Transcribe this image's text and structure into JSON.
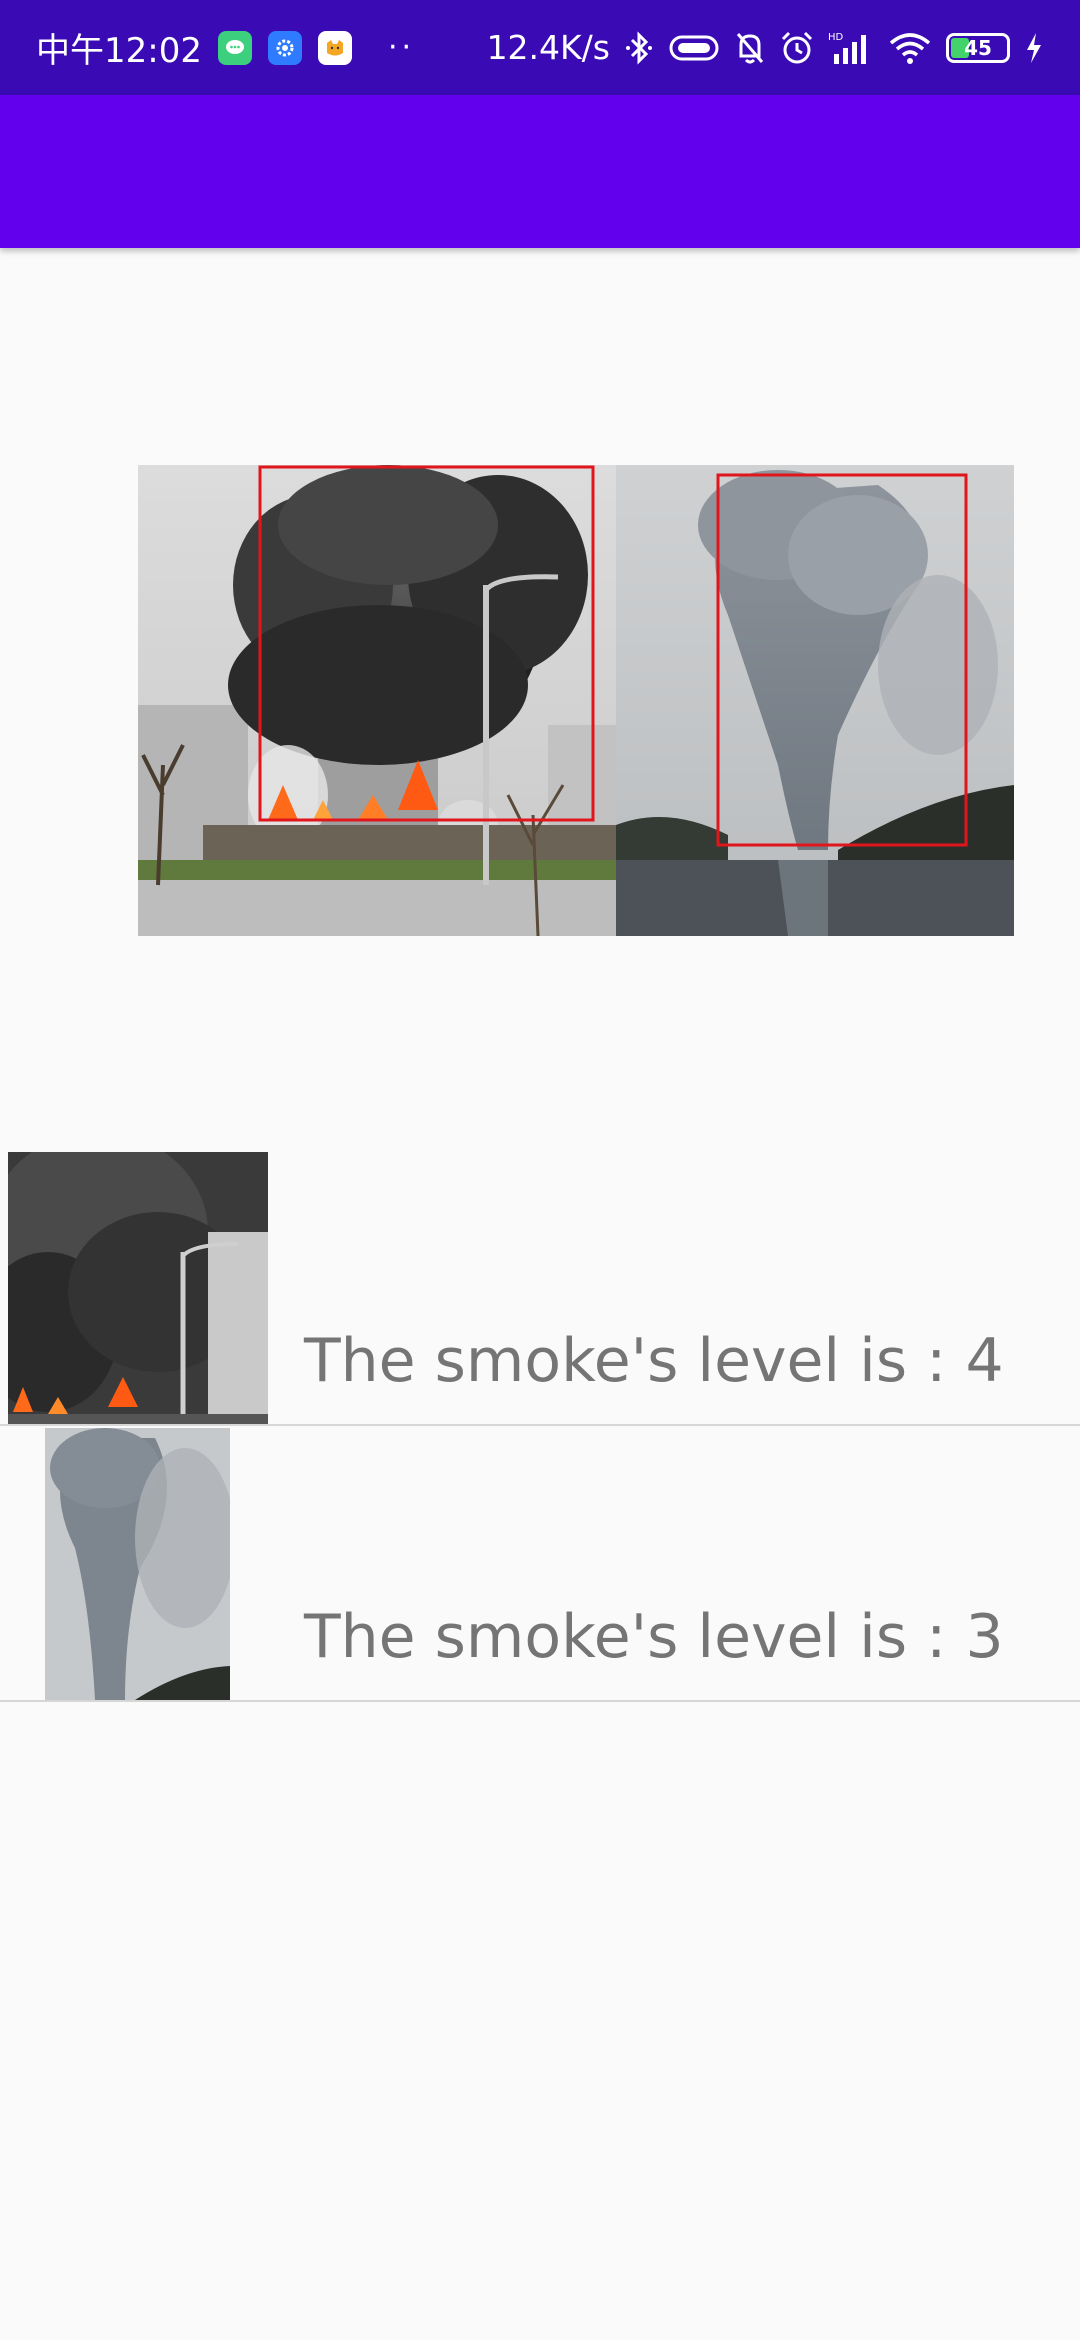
{
  "status_bar": {
    "time": "中午12:02",
    "dots": "··",
    "network_speed": "12.4K/s",
    "hd_label": "HD",
    "battery_level": "45",
    "icons": [
      "messaging-app-icon",
      "settings-app-icon",
      "cat-app-icon",
      "bluetooth-icon",
      "vibrate-icon",
      "mute-bell-icon",
      "alarm-icon",
      "signal-icon",
      "wifi-icon",
      "battery-icon",
      "charging-icon"
    ]
  },
  "app_bar": {
    "color": "#6200ee"
  },
  "detection_image": {
    "description_boxes": 2,
    "box_color": "#e0161c"
  },
  "results": [
    {
      "label": "The smoke's level is : 4",
      "thumbnail": "fire-smoke-thumbnail"
    },
    {
      "label": "The smoke's level is : 3",
      "thumbnail": "smoke-column-thumbnail"
    }
  ]
}
